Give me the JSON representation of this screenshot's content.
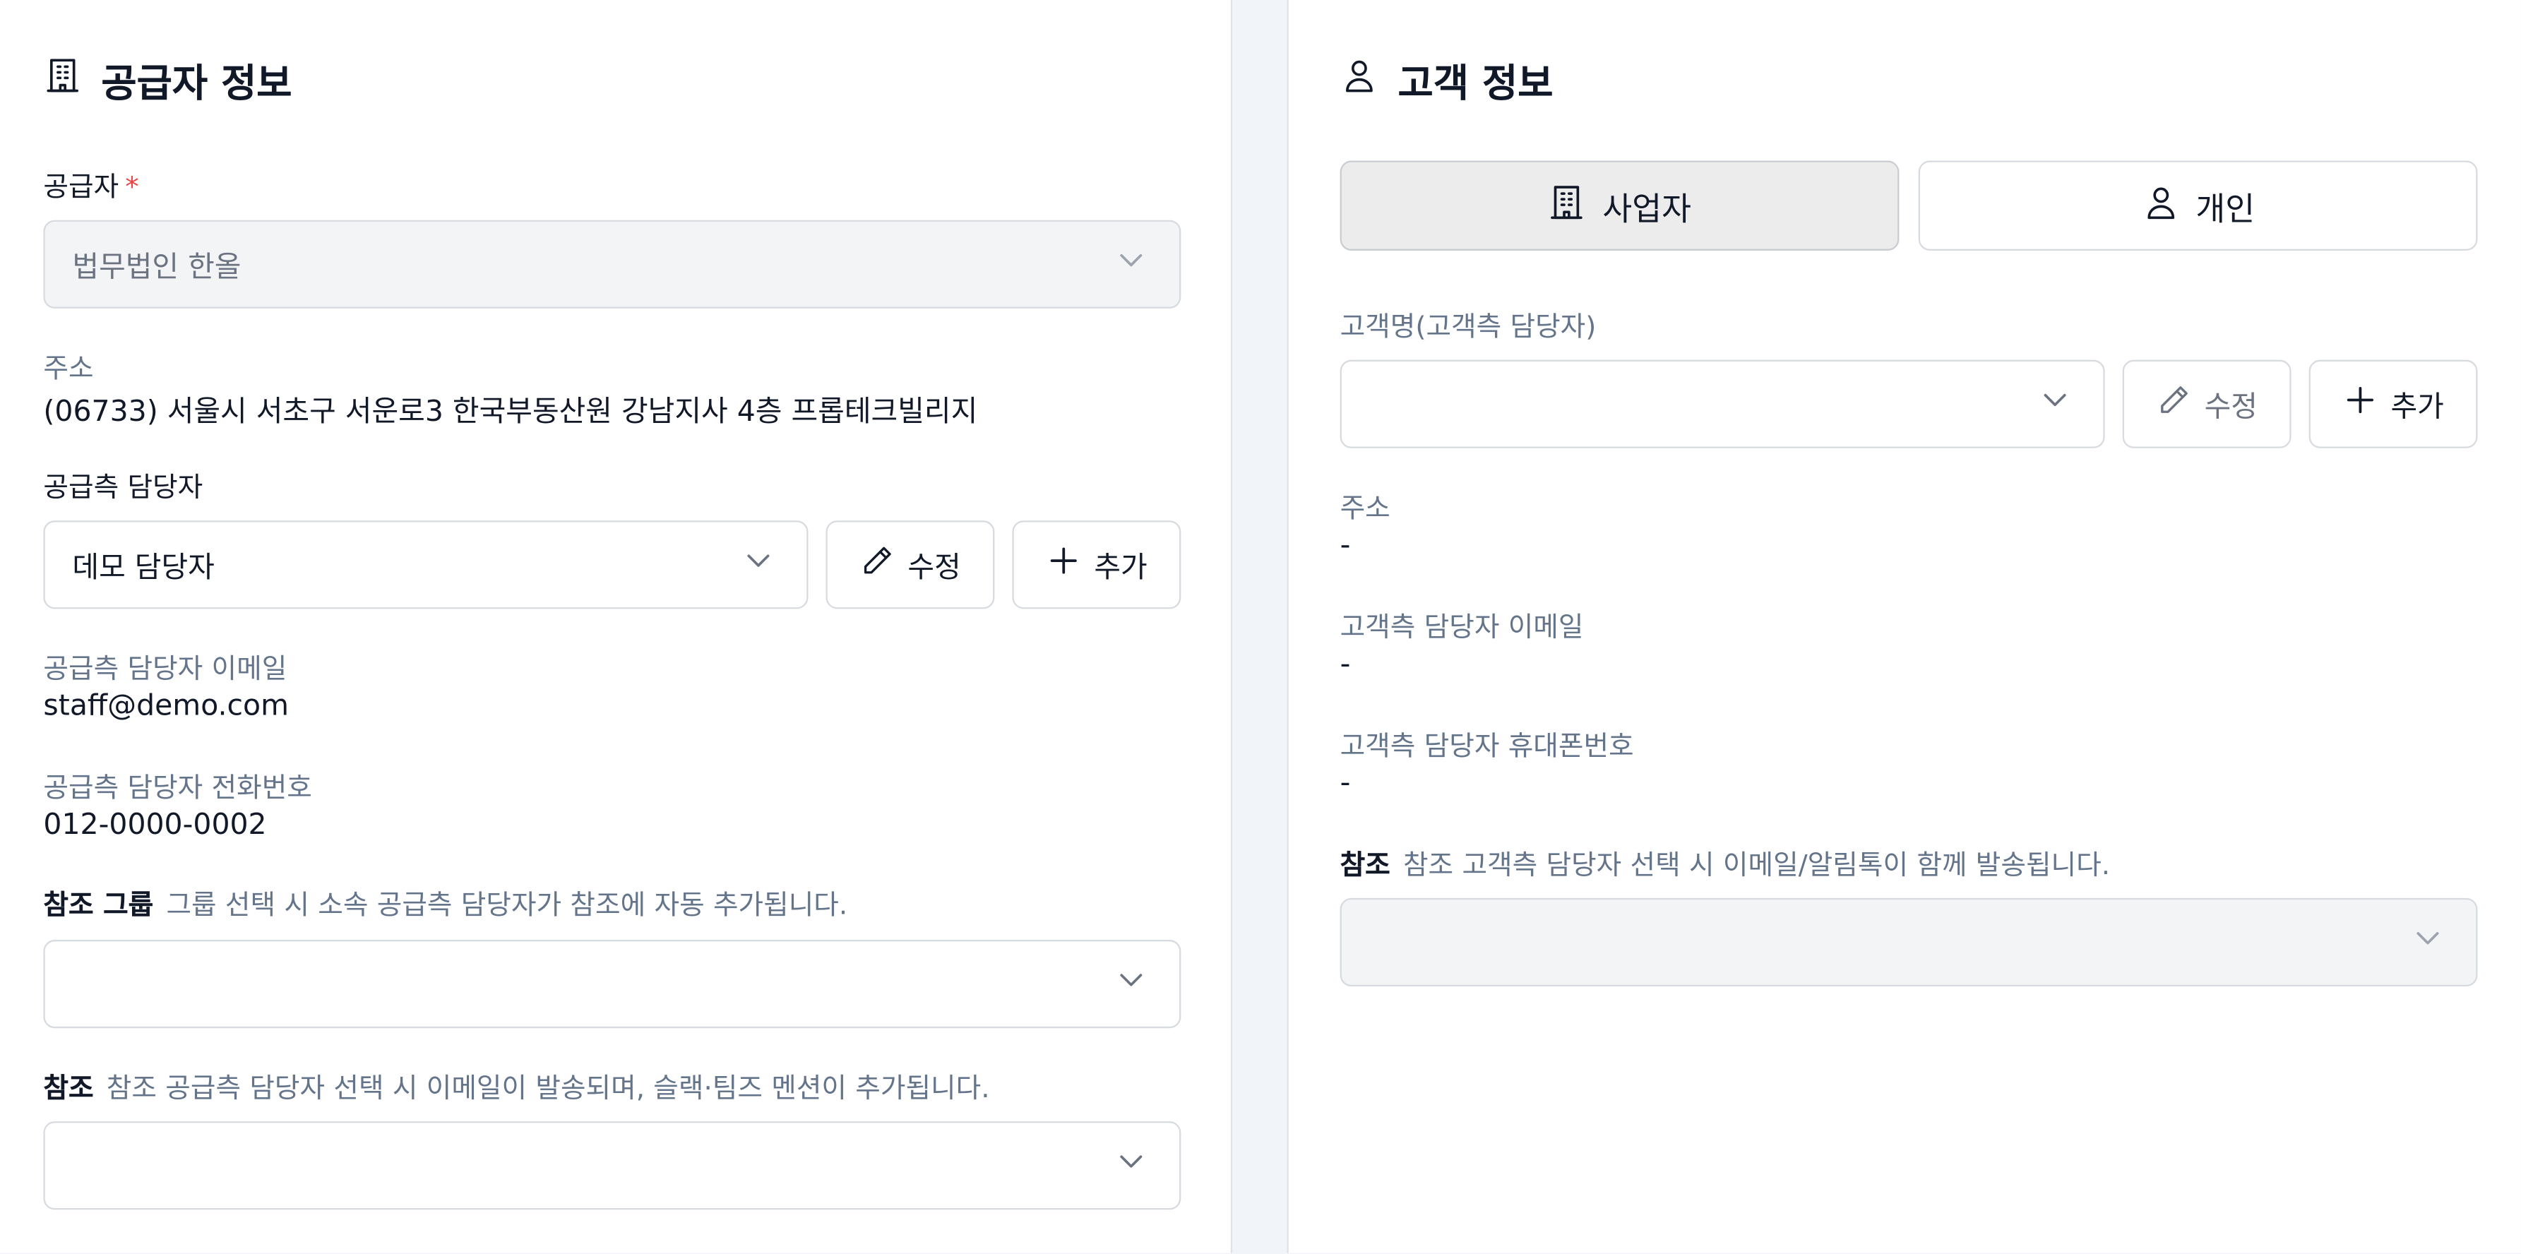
{
  "supplier": {
    "title": "공급자 정보",
    "supplier_label": "공급자",
    "required_mark": "*",
    "supplier_value": "법무법인 한올",
    "address_label": "주소",
    "address_value": "(06733) 서울시 서초구 서운로3 한국부동산원 강남지사 4층 프롭테크빌리지",
    "staff_label": "공급측 담당자",
    "staff_value": "데모 담당자",
    "edit_label": "수정",
    "add_label": "추가",
    "email_label": "공급측 담당자 이메일",
    "email_value": "staff@demo.com",
    "phone_label": "공급측 담당자 전화번호",
    "phone_value": "012-0000-0002",
    "cc_group_label": "참조 그룹",
    "cc_group_hint": "그룹 선택 시 소속 공급측 담당자가 참조에 자동 추가됩니다.",
    "cc_label": "참조",
    "cc_hint": "참조 공급측 담당자 선택 시 이메일이 발송되며, 슬랙·팀즈 멘션이 추가됩니다."
  },
  "customer": {
    "title": "고객 정보",
    "type_business": "사업자",
    "type_individual": "개인",
    "active_type": "business",
    "name_label": "고객명(고객측 담당자)",
    "edit_label": "수정",
    "add_label": "추가",
    "address_label": "주소",
    "address_value": "-",
    "email_label": "고객측 담당자 이메일",
    "email_value": "-",
    "mobile_label": "고객측 담당자 휴대폰번호",
    "mobile_value": "-",
    "cc_label": "참조",
    "cc_hint": "참조 고객측 담당자 선택 시 이메일/알림톡이 함께 발송됩니다."
  },
  "icons": {
    "supplier_title": "building-icon",
    "customer_title": "user-icon",
    "dropdown": "chevron-down-icon",
    "edit": "pencil-icon",
    "add": "plus-icon"
  },
  "colors": {
    "required": "#ef4444",
    "muted_label": "#64748b",
    "border": "#d7dbe0",
    "disabled_bg": "#f3f4f6",
    "active_toggle_bg": "#ececec"
  }
}
